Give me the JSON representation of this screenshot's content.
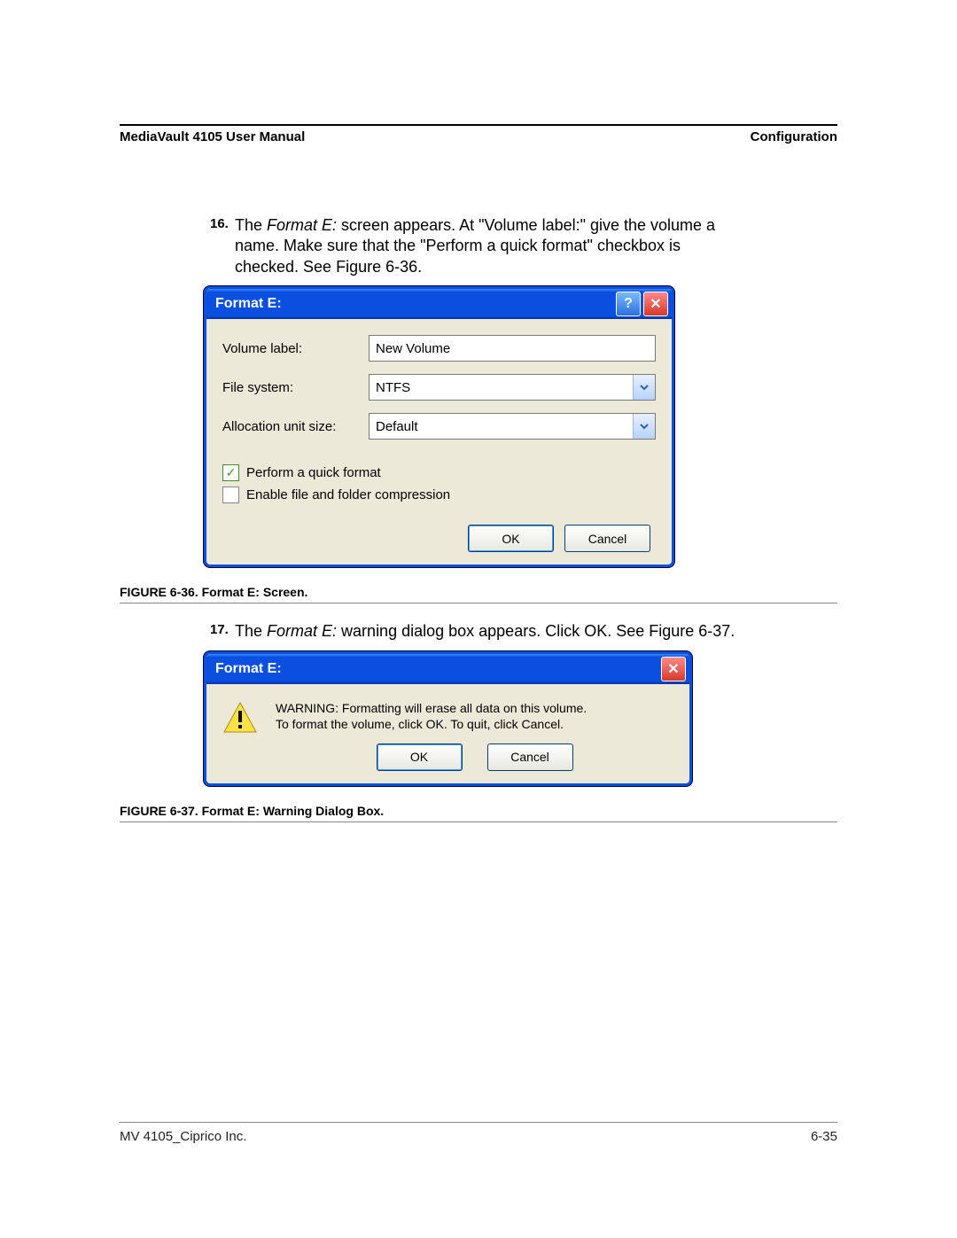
{
  "header": {
    "left": "MediaVault 4105 User Manual",
    "right": "Configuration"
  },
  "step16": {
    "num": "16.",
    "line1a": "The ",
    "line1b": "Format E:",
    "line1c": " screen appears. At \"Volume label:\" give the volume a",
    "line2": "name. Make sure that the \"Perform a quick format\" checkbox is",
    "line3": "checked. See Figure 6-36."
  },
  "dialog1": {
    "title": "Format E:",
    "labels": {
      "volume": "Volume label:",
      "fs": "File system:",
      "alloc": "Allocation unit size:"
    },
    "values": {
      "volume": "New Volume",
      "fs": "NTFS",
      "alloc": "Default"
    },
    "checks": {
      "quick": "Perform a quick format",
      "compress": "Enable file and folder compression"
    },
    "buttons": {
      "ok": "OK",
      "cancel": "Cancel"
    }
  },
  "figcap1": {
    "prefix": "FIGURE 6-36.",
    "text": " Format E: Screen."
  },
  "step17": {
    "num": "17.",
    "a": "The ",
    "b": "Format E:",
    "c": " warning dialog box appears. Click ",
    "d": "OK",
    "e": ". See Figure 6-37."
  },
  "dialog2": {
    "title": "Format E:",
    "line1": "WARNING: Formatting will erase all data on this volume.",
    "line2": "To format the volume, click OK. To quit, click Cancel.",
    "buttons": {
      "ok": "OK",
      "cancel": "Cancel"
    }
  },
  "figcap2": {
    "prefix": "FIGURE 6-37.",
    "text": " Format E: Warning Dialog Box."
  },
  "footer": {
    "left": "MV 4105_Ciprico Inc.",
    "right": "6-35"
  }
}
